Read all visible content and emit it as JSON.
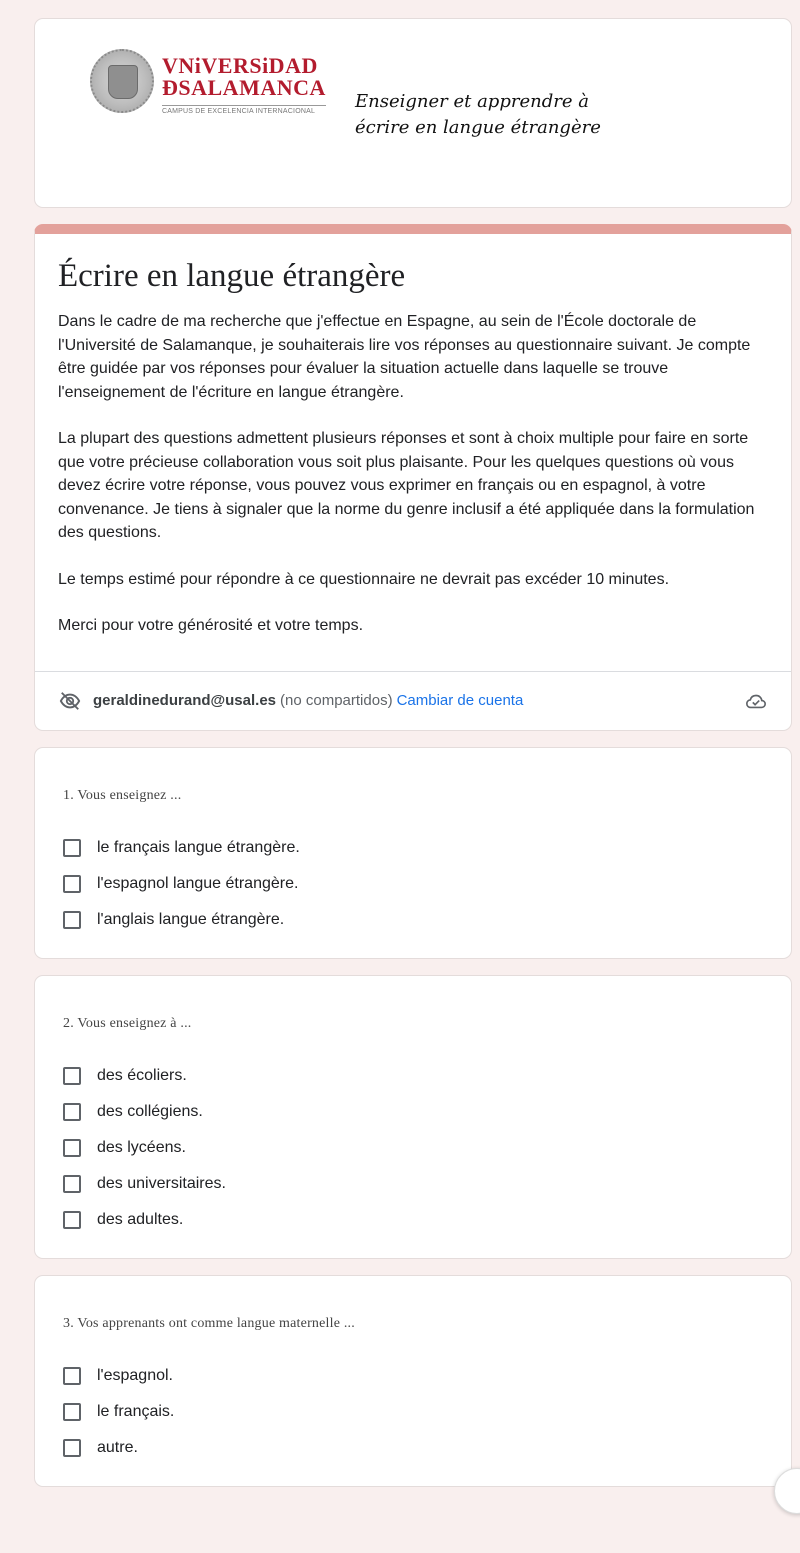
{
  "banner": {
    "logo_line1": "VNiVERSiDAD",
    "logo_line2": "ÐSALAMANCA",
    "logo_sub": "CAMPUS DE EXCELENCIA INTERNACIONAL",
    "title_line1": "Enseigner et apprendre à",
    "title_line2": "écrire en langue étrangère"
  },
  "intro": {
    "title": "Écrire en langue étrangère",
    "paragraphs": [
      "Dans le cadre de ma recherche que j'effectue en Espagne, au sein de l'École doctorale de l'Université de Salamanque, je souhaiterais lire vos réponses au questionnaire suivant. Je compte être guidée par vos réponses pour évaluer la situation actuelle dans laquelle se trouve l'enseignement de l'écriture en langue étrangère.",
      "La plupart des questions admettent plusieurs réponses et sont à choix multiple pour faire en sorte que votre précieuse collaboration vous soit plus plaisante. Pour les quelques questions où vous devez écrire votre réponse, vous pouvez vous exprimer en français ou en espagnol, à votre convenance. Je tiens à signaler que la norme du genre inclusif a été appliquée dans la formulation des questions.",
      "Le temps estimé pour répondre à ce questionnaire ne devrait pas excéder 10 minutes.",
      "Merci pour votre générosité et votre temps."
    ]
  },
  "account": {
    "icon": "eye-off-icon",
    "email": "geraldinedurand@usal.es",
    "not_shared": "(no compartidos)",
    "switch_label": "Cambiar de cuenta",
    "status_icon": "cloud-check-icon"
  },
  "questions": [
    {
      "title": "1. Vous enseignez ...",
      "options": [
        "le français langue étrangère.",
        "l'espagnol langue étrangère.",
        "l'anglais langue étrangère."
      ]
    },
    {
      "title": "2. Vous enseignez à  ...",
      "options": [
        "des écoliers.",
        "des collégiens.",
        "des lycéens.",
        "des universitaires.",
        "des adultes."
      ]
    },
    {
      "title": "3. Vos apprenants ont comme langue maternelle ...",
      "options": [
        "l'espagnol.",
        "le français.",
        "autre."
      ]
    }
  ],
  "colors": {
    "background": "#f9efee",
    "accent": "#e3a19b",
    "brand_red": "#b31c2e",
    "link": "#1a73e8"
  }
}
